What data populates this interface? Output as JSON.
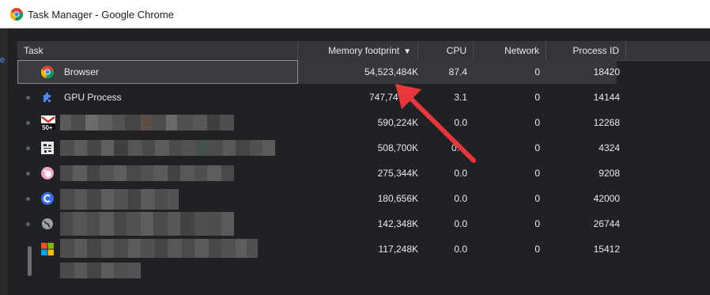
{
  "window": {
    "title": "Task Manager - Google Chrome"
  },
  "columns": {
    "task": "Task",
    "memory": "Memory footprint",
    "sort_indicator": "▼",
    "cpu": "CPU",
    "network": "Network",
    "pid": "Process ID"
  },
  "rows": [
    {
      "name": "Browser",
      "memory": "54,523,484K",
      "cpu": "87.4",
      "network": "0",
      "pid": "18420",
      "icon": "chrome-icon"
    },
    {
      "name": "GPU Process",
      "memory": "747,74",
      "cpu": "3.1",
      "network": "0",
      "pid": "14144",
      "icon": "puzzle-icon"
    },
    {
      "name": "",
      "memory": "590,224K",
      "cpu": "0.0",
      "network": "0",
      "pid": "12268",
      "icon": "gmail-icon"
    },
    {
      "name": "",
      "memory": "508,700K",
      "cpu": "0.",
      "network": "0",
      "pid": "4324",
      "icon": "tab-icon"
    },
    {
      "name": "",
      "memory": "275,344K",
      "cpu": "0.0",
      "network": "0",
      "pid": "9208",
      "icon": "pig-icon"
    },
    {
      "name": "",
      "memory": "180,656K",
      "cpu": "0.0",
      "network": "0",
      "pid": "42000",
      "icon": "c-icon"
    },
    {
      "name": "",
      "memory": "142,348K",
      "cpu": "0.0",
      "network": "0",
      "pid": "26744",
      "icon": "globe-icon"
    },
    {
      "name": "",
      "memory": "117,248K",
      "cpu": "0.0",
      "network": "0",
      "pid": "15412",
      "icon": "windows-icon"
    }
  ],
  "gmail_badge": "50+",
  "colors": {
    "background": "#202124",
    "header": "#35363a",
    "selected": "#3c3d41",
    "annotation_arrow": "#e8373a",
    "text": "#e8eaed"
  }
}
